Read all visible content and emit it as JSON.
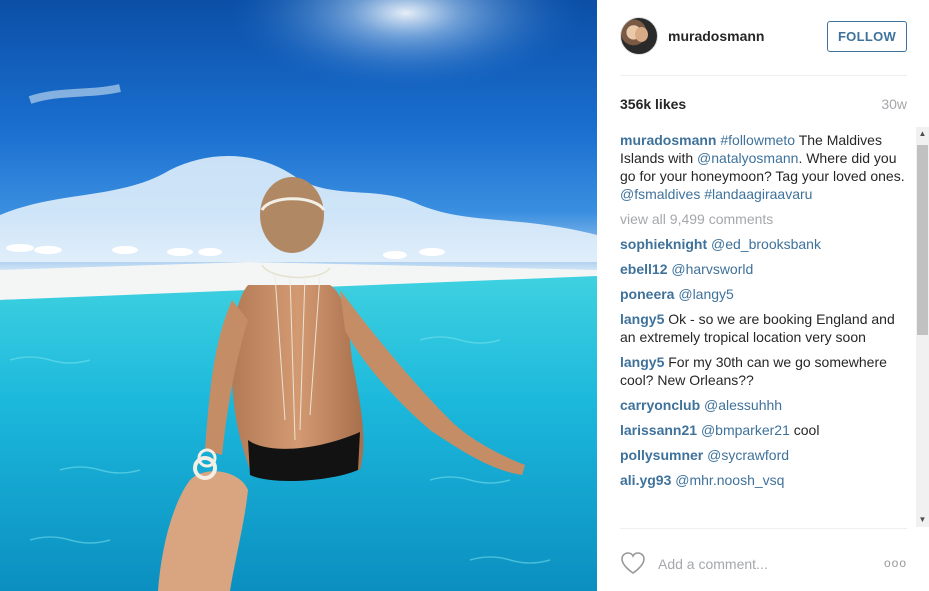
{
  "post": {
    "username": "muradosmann",
    "follow_label": "FOLLOW",
    "likes": "356k likes",
    "age": "30w"
  },
  "caption": {
    "user": "muradosmann",
    "parts": [
      "#followmeto",
      " The Maldives Islands with ",
      "@natalyosmann",
      ". Where did you go for your honeymoon? Tag your loved ones. ",
      "@fsmaldives",
      " ",
      "#landaagiraavaru"
    ]
  },
  "view_all": "view all 9,499 comments",
  "comments": [
    {
      "user": "sophieknight",
      "text": "@ed_brooksbank",
      "is_link": true
    },
    {
      "user": "ebell12",
      "text": "@harvsworld",
      "is_link": true
    },
    {
      "user": "poneera",
      "text": "@langy5",
      "is_link": true
    },
    {
      "user": "langy5",
      "text": "Ok - so we are booking England and an extremely tropical location very soon",
      "is_link": false
    },
    {
      "user": "langy5",
      "text": "For my 30th can we go somewhere cool? New Orleans??",
      "is_link": false
    },
    {
      "user": "carryonclub",
      "text": "@alessuhhh",
      "is_link": true
    },
    {
      "user": "larissann21",
      "text": "@bmparker21",
      "is_link": true,
      "suffix": " cool"
    },
    {
      "user": "pollysumner",
      "text": "@sycrawford",
      "is_link": true
    },
    {
      "user": "ali.yg93",
      "text": "@mhr.noosh_vsq",
      "is_link": true
    }
  ],
  "footer": {
    "add_comment_placeholder": "Add a comment...",
    "more_label": "ooo"
  },
  "icons": {
    "avatar": "avatar",
    "heart": "heart-icon",
    "more": "more-options-icon"
  }
}
